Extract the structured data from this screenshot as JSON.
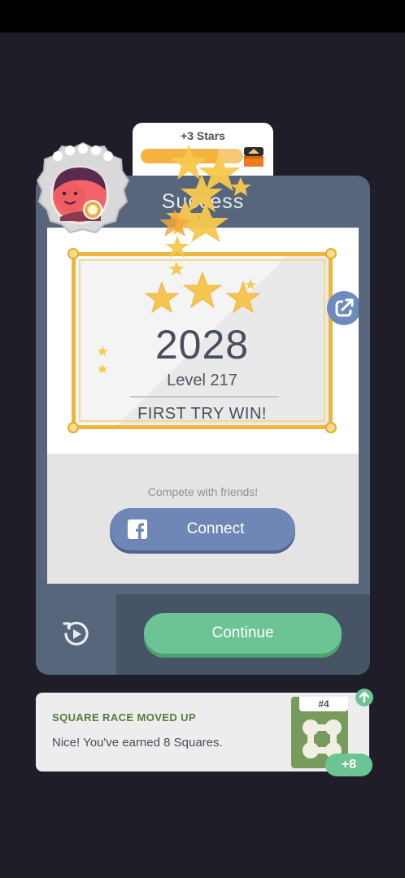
{
  "reward": {
    "label": "+3 Stars",
    "progress": 0.75,
    "colors": {
      "bar": "#f7c873",
      "fill": "#f4b23f",
      "chest": "#f07b1a"
    },
    "chest_icon": "treasure-chest-icon"
  },
  "card": {
    "title": "Success",
    "score": "2028",
    "level": "Level 217",
    "result": "FIRST TRY WIN!",
    "share_icon": "share-external-icon",
    "frame_color": "#eab73f"
  },
  "social": {
    "prompt": "Compete with friends!",
    "connect_label": "Connect",
    "facebook_icon": "facebook-icon",
    "color": "#6f87b7"
  },
  "actions": {
    "replay_icon": "replay-icon",
    "continue_label": "Continue",
    "continue_color": "#6cc494"
  },
  "avatar": {
    "icon": "player-avatar-icon"
  },
  "notification": {
    "title": "SQUARE RACE MOVED UP",
    "body": "Nice! You've earned 8 Squares.",
    "rank": "#4",
    "bonus": "+8",
    "rank_up_icon": "arrow-up-icon",
    "squares_icon": "squares-icon"
  }
}
